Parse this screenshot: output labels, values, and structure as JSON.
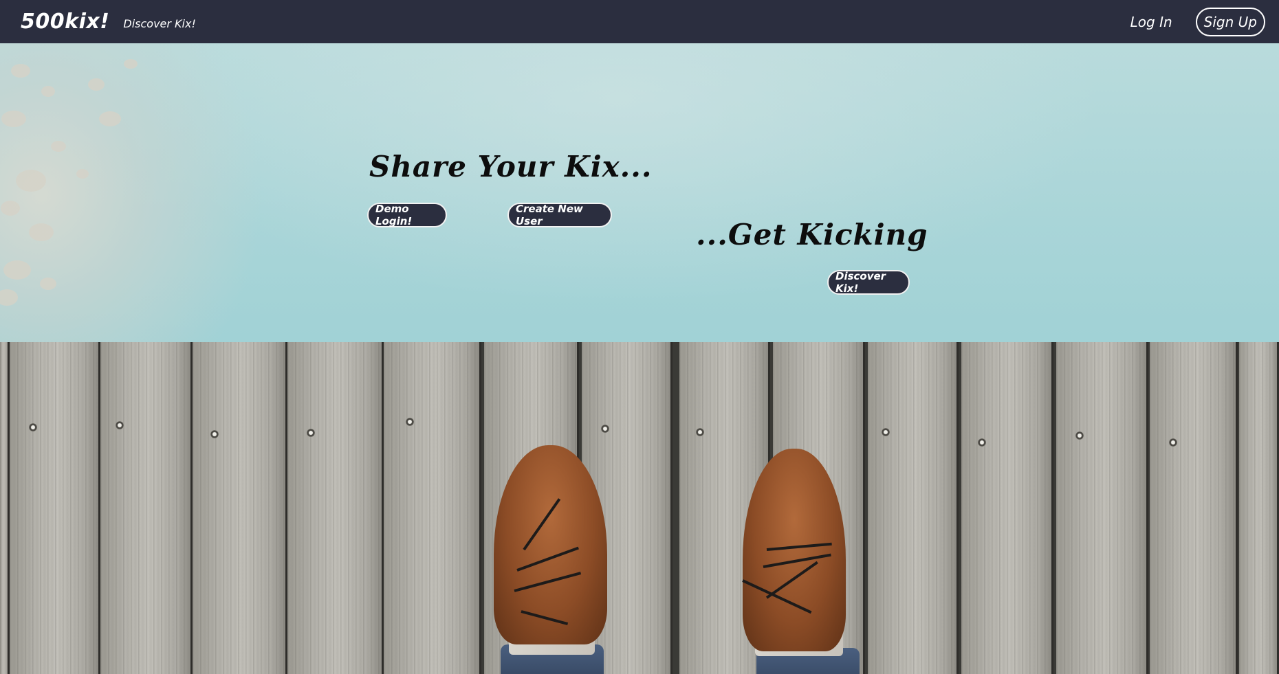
{
  "navbar": {
    "brand": "500kix!",
    "discover_link": "Discover Kix!",
    "login_link": "Log In",
    "signup_button": "Sign Up"
  },
  "hero": {
    "headline_share": "Share Your Kix...",
    "demo_login_button": "Demo Login!",
    "create_user_button": "Create New User",
    "headline_kicking": "...Get Kicking",
    "discover_button": "Discover Kix!"
  },
  "colors": {
    "navbar_bg": "#2b2e3f",
    "button_bg": "#2b2e3f",
    "text_dark": "#0d0d0d",
    "water": "#a9d5d8"
  }
}
